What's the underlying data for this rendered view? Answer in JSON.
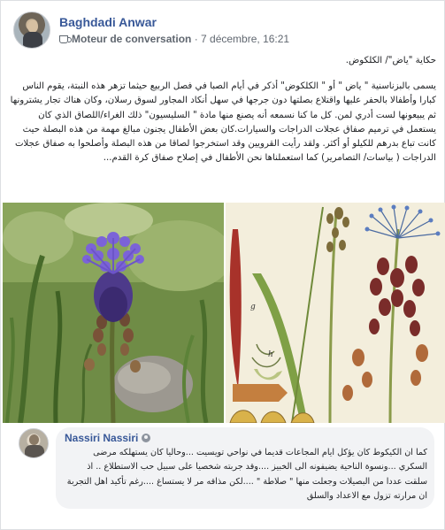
{
  "post": {
    "author": "Baghdadi Anwar",
    "group": "Moteur de conversation",
    "separator": " · ",
    "timestamp": "7 décembre, 16:21",
    "group_icon": "coffee-mug-icon",
    "title": "حكاية \"ياض\"/ الكلكوض.",
    "body": "يسمى بالبزناسنية \" ياض \" أو \" الكلكوض\" أذكر في أيام الصبا في فصل الربيع حيثما تزهر هذه النبتة، يقوم الناس كبارا وأطفالا بالحفر عليها واقتلاع بصلتها دون جرجها في سهل أنكاد المجاور لسوق رسلان، وكان هناك تجار يشترونها ثم يبيعونها لست أدري لمن. كل ما كنا نسمعه أنه يصنع منها مادة \" السليسيون\" ذلك الغراء/اللصاق الذي كان يستعمل في ترميم صفاق عجلات الدراجات والسيارات.كان بعض الأطفال يجنون مبالغ مهمة من هذه البصلة حيث كانت تباع بدرهم للكيلو أو أكثر. ولقد رأيت القرويين وقد استخرجوا لصاقا من هذه البصلة وأصلحوا به صفاق عجلات الدراجات ( بياسات/ التصامرير) كما استعملناها نحن الأطفال في إصلاح صفاق كرة القدم...",
    "photos": [
      "photo-grape-hyacinth-flower",
      "photo-botanical-illustration"
    ]
  },
  "comment": {
    "author": "Nassiri Nassiri",
    "badge_icon": "profile-badge-icon",
    "text": "كما ان الكيكوط كان يؤكل ايام المجاعات قديما في نواحي تويسيت ...وحاليا كان يستهلكه مرضى السكري ...ونسوة الناحية يضيفونه الى الخبيز ....وقد جربته شخصيا على سبيل حب الاستطلاع .. اذ سلقت عددا من البصيلات وجعلت منها \" صلاطة \" ....لكن مذاقه مر لا يستساغ ....رغم تأكيد اهل التجربة ان مرارته تزول مع الاعداد والسلق"
  }
}
